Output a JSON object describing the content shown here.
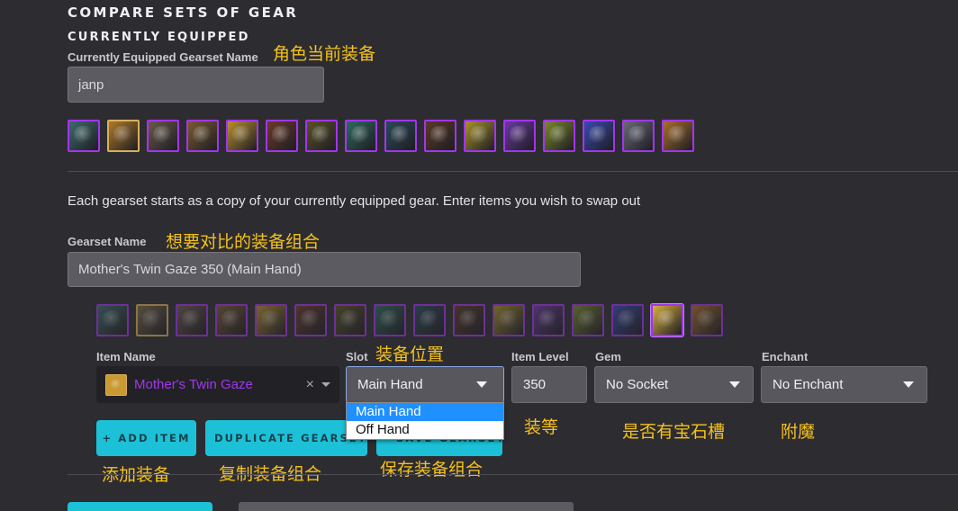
{
  "page": {
    "title": "COMPARE SETS OF GEAR",
    "currently_equipped_title": "CURRENTLY EQUIPPED",
    "equipped_name_label": "Currently Equipped Gearset Name",
    "equipped_name_value": "janp",
    "info_text": "Each gearset starts as a copy of your currently equipped gear. Enter items you wish to swap out",
    "gearset_name_label": "Gearset Name",
    "gearset_name_value": "Mother's Twin Gaze 350 (Main Hand)"
  },
  "annotations": {
    "equipped": "角色当前装备",
    "compare_sets": "想要对比的装备组合",
    "slot": "装备位置",
    "item_level": "装等",
    "gem": "是否有宝石槽",
    "enchant": "附魔",
    "add_item": "添加装备",
    "duplicate": "复制装备组合",
    "save": "保存装备组合"
  },
  "equipped_gear": [
    {
      "icon": "helm-icon",
      "quality": "epic",
      "color": "#3d6a6a"
    },
    {
      "icon": "neck-icon",
      "quality": "legendary",
      "color": "#b07a2a"
    },
    {
      "icon": "shoulder-icon",
      "quality": "epic",
      "color": "#6a5a4a"
    },
    {
      "icon": "back-icon",
      "quality": "epic",
      "color": "#7a5a30"
    },
    {
      "icon": "chest-icon",
      "quality": "epic",
      "color": "#b8902e"
    },
    {
      "icon": "wrist-icon",
      "quality": "epic",
      "color": "#6a3a2a"
    },
    {
      "icon": "hands-icon",
      "quality": "epic",
      "color": "#5a5226"
    },
    {
      "icon": "waist-icon",
      "quality": "epic",
      "color": "#2d6a5e"
    },
    {
      "icon": "legs-icon",
      "quality": "epic",
      "color": "#2a4a5a"
    },
    {
      "icon": "feet-icon",
      "quality": "epic",
      "color": "#5a3a26"
    },
    {
      "icon": "ring-icon",
      "quality": "epic",
      "color": "#a8922a"
    },
    {
      "icon": "ring-2-icon",
      "quality": "epic",
      "color": "#6a3aa0"
    },
    {
      "icon": "trinket-icon",
      "quality": "epic",
      "color": "#7a8a2a"
    },
    {
      "icon": "trinket-2-icon",
      "quality": "epic",
      "color": "#3a4ab0"
    },
    {
      "icon": "main-hand-icon",
      "quality": "epic",
      "color": "#6a6a7a"
    },
    {
      "icon": "off-hand-icon",
      "quality": "epic",
      "color": "#a8702a"
    }
  ],
  "compare_gear": [
    {
      "icon": "helm-icon",
      "quality": "epic",
      "color": "#3d6a6a"
    },
    {
      "icon": "neck-icon",
      "quality": "legendary",
      "color": "#7a6a4a"
    },
    {
      "icon": "shoulder-icon",
      "quality": "epic",
      "color": "#6a5a4a"
    },
    {
      "icon": "back-icon",
      "quality": "epic",
      "color": "#7a5a30"
    },
    {
      "icon": "chest-icon",
      "quality": "epic",
      "color": "#b8902e"
    },
    {
      "icon": "wrist-icon",
      "quality": "epic",
      "color": "#6a3a2a"
    },
    {
      "icon": "hands-icon",
      "quality": "epic",
      "color": "#5a5226"
    },
    {
      "icon": "waist-icon",
      "quality": "epic",
      "color": "#2d6a5e"
    },
    {
      "icon": "legs-icon",
      "quality": "epic",
      "color": "#2a4a5a"
    },
    {
      "icon": "feet-icon",
      "quality": "epic",
      "color": "#5a3a26"
    },
    {
      "icon": "ring-icon",
      "quality": "epic",
      "color": "#a8922a"
    },
    {
      "icon": "ring-2-icon",
      "quality": "epic",
      "color": "#6a3aa0"
    },
    {
      "icon": "trinket-icon",
      "quality": "epic",
      "color": "#7a8a2a"
    },
    {
      "icon": "trinket-2-icon",
      "quality": "epic",
      "color": "#3a4ab0"
    },
    {
      "icon": "main-hand-icon",
      "quality": "epic",
      "color": "#d8b040",
      "selected": true
    },
    {
      "icon": "off-hand-icon",
      "quality": "epic",
      "color": "#a8702a"
    }
  ],
  "item_form": {
    "item_name_label": "Item Name",
    "item_name_value": "Mother's Twin Gaze",
    "item_icon": "mothers-twin-gaze-icon",
    "item_name_color": "#a335ee",
    "slot_label": "Slot",
    "slot_value": "Main Hand",
    "slot_options": [
      "Main Hand",
      "Off Hand"
    ],
    "slot_highlighted": "Main Hand",
    "item_level_label": "Item Level",
    "item_level_value": "350",
    "gem_label": "Gem",
    "gem_value": "No Socket",
    "enchant_label": "Enchant",
    "enchant_value": "No Enchant"
  },
  "buttons": {
    "add_item": "+ ADD ITEM",
    "duplicate_gearset": "DUPLICATE GEARSET",
    "save_gearset": "SAVE GEARSET"
  },
  "colors": {
    "background": "#2d2c31",
    "accent": "#1cc1d8",
    "annotation": "#f5c21b",
    "epic": "#a335ee",
    "legendary": "#d8b05a"
  }
}
